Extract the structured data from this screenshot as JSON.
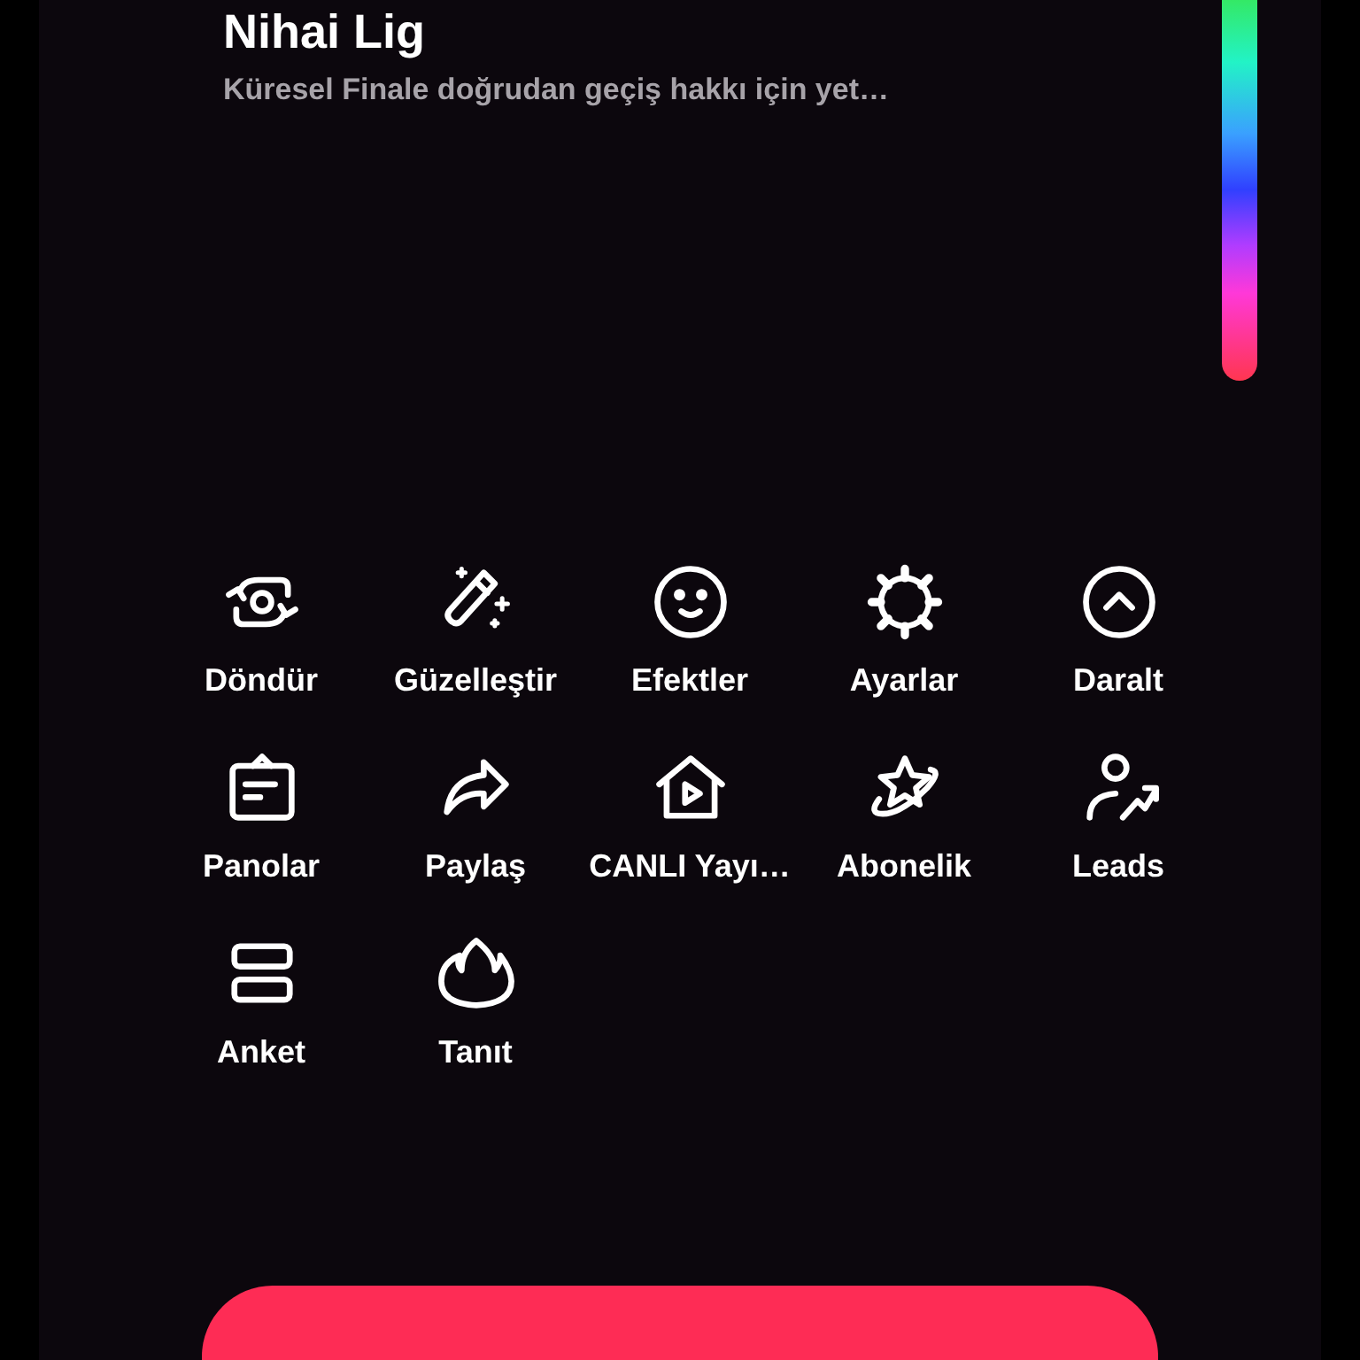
{
  "header": {
    "title": "Nihai Lig",
    "subtitle": "Küresel Finale doğrudan geçiş hakkı için yet…"
  },
  "actions": [
    {
      "label": "Döndür"
    },
    {
      "label": "Güzelleştir"
    },
    {
      "label": "Efektler"
    },
    {
      "label": "Ayarlar"
    },
    {
      "label": "Daralt"
    },
    {
      "label": "Panolar"
    },
    {
      "label": "Paylaş"
    },
    {
      "label": "CANLI Yayı…"
    },
    {
      "label": "Abonelik"
    },
    {
      "label": "Leads"
    },
    {
      "label": "Anket"
    },
    {
      "label": "Tanıt"
    }
  ],
  "primary_button": {
    "kind": "button"
  }
}
